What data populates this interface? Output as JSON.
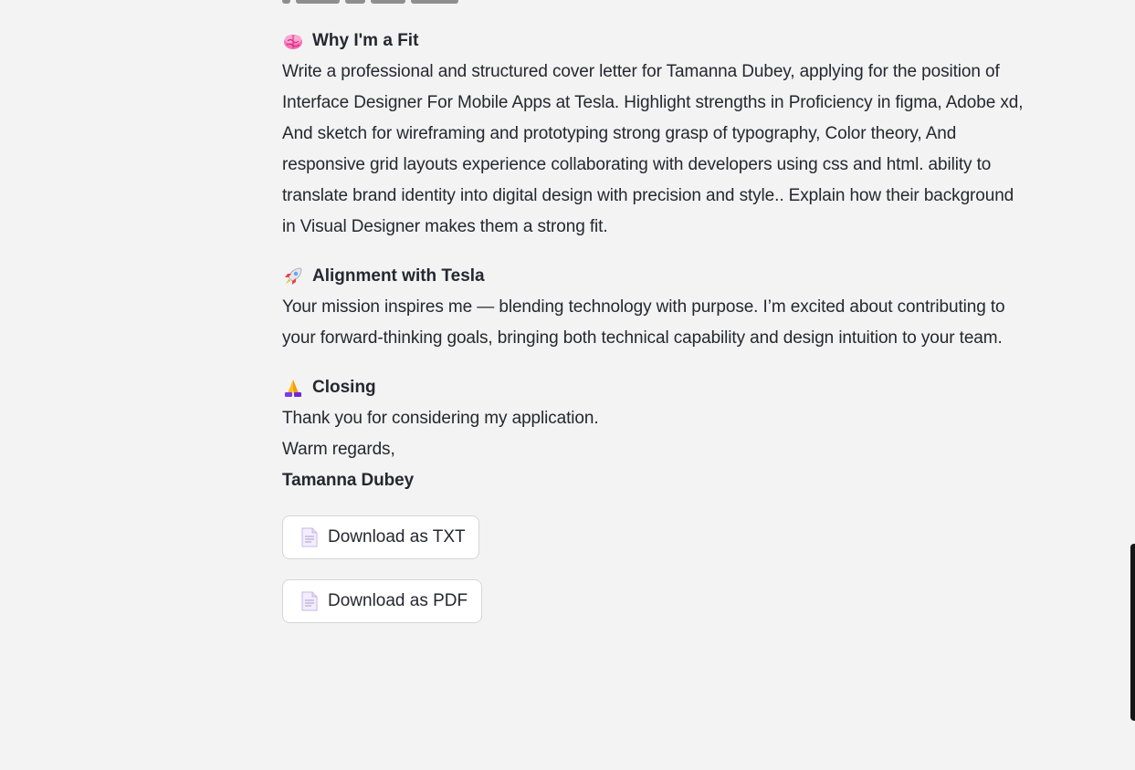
{
  "letter": {
    "fit": {
      "emoji": "brain-icon",
      "heading": "Why I'm a Fit",
      "lines": [
        "Write a professional and structured cover letter for Tamanna Dubey, applying for the position of",
        "Interface Designer For Mobile Apps at Tesla. Highlight strengths in Proficiency in figma, Adobe xd,",
        "And sketch for wireframing and prototyping strong grasp of typography, Color theory, And",
        "responsive grid layouts experience collaborating with developers using css and html. ability to",
        "translate brand identity into digital design with precision and style.. Explain how their background",
        "in Visual Designer makes them a strong fit."
      ]
    },
    "alignment": {
      "emoji": "rocket-icon",
      "heading": "Alignment with Tesla",
      "lines": [
        "Your mission inspires me — blending technology with purpose. I’m excited about contributing to",
        "your forward-thinking goals, bringing both technical capability and design intuition to your team."
      ]
    },
    "closing": {
      "emoji": "folded-hands-icon",
      "heading": "Closing",
      "thanks": "Thank you for considering my application.",
      "signoff": "Warm regards,",
      "name": "Tamanna Dubey"
    }
  },
  "downloads": {
    "txt_label": "Download as TXT",
    "pdf_label": "Download as PDF",
    "icon": "page-facing-up-icon"
  },
  "colors": {
    "background": "#f3f3f3",
    "text": "#262730",
    "button_border": "#d6d6db",
    "button_bg": "#ffffff"
  }
}
